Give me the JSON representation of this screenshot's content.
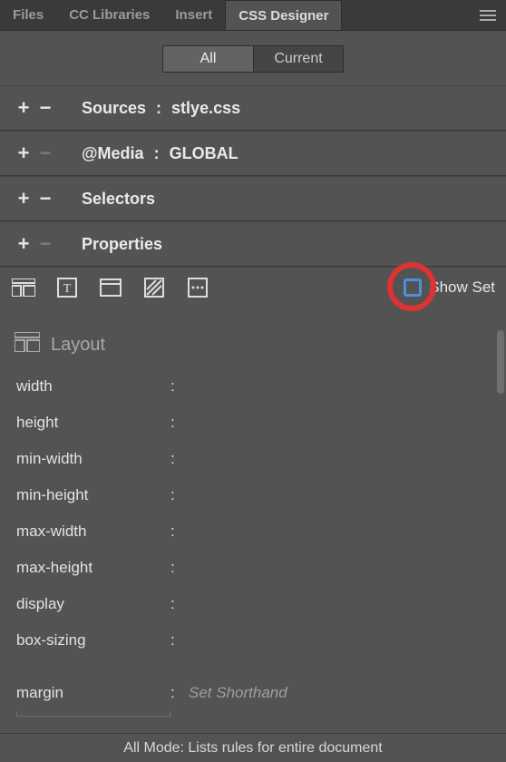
{
  "tabs": {
    "items": [
      {
        "label": "Files",
        "active": false
      },
      {
        "label": "CC Libraries",
        "active": false
      },
      {
        "label": "Insert",
        "active": false
      },
      {
        "label": "CSS Designer",
        "active": true
      }
    ]
  },
  "mode": {
    "all": "All",
    "current": "Current",
    "active": "all"
  },
  "sections": {
    "sources": {
      "label": "Sources",
      "value": "stlye.css",
      "plus_enabled": true,
      "minus_enabled": true
    },
    "media": {
      "label": "@Media",
      "value": "GLOBAL",
      "plus_enabled": true,
      "minus_enabled": false
    },
    "selectors": {
      "label": "Selectors",
      "plus_enabled": true,
      "minus_enabled": true
    },
    "properties": {
      "label": "Properties",
      "plus_enabled": true,
      "minus_enabled": false
    }
  },
  "categories": {
    "layout": "Layout category",
    "text": "Text category",
    "border": "Border category",
    "background": "Background category",
    "more": "More"
  },
  "showset": {
    "label": "Show Set",
    "checked": false
  },
  "layout": {
    "heading": "Layout",
    "props": [
      {
        "name": "width"
      },
      {
        "name": "height"
      },
      {
        "name": "min-width"
      },
      {
        "name": "min-height"
      },
      {
        "name": "max-width"
      },
      {
        "name": "max-height"
      },
      {
        "name": "display"
      },
      {
        "name": "box-sizing"
      }
    ],
    "margin": {
      "name": "margin",
      "placeholder": "Set Shorthand"
    }
  },
  "footer": "All Mode: Lists rules for entire document",
  "annotation": {
    "highlight": "show-set-checkbox"
  }
}
